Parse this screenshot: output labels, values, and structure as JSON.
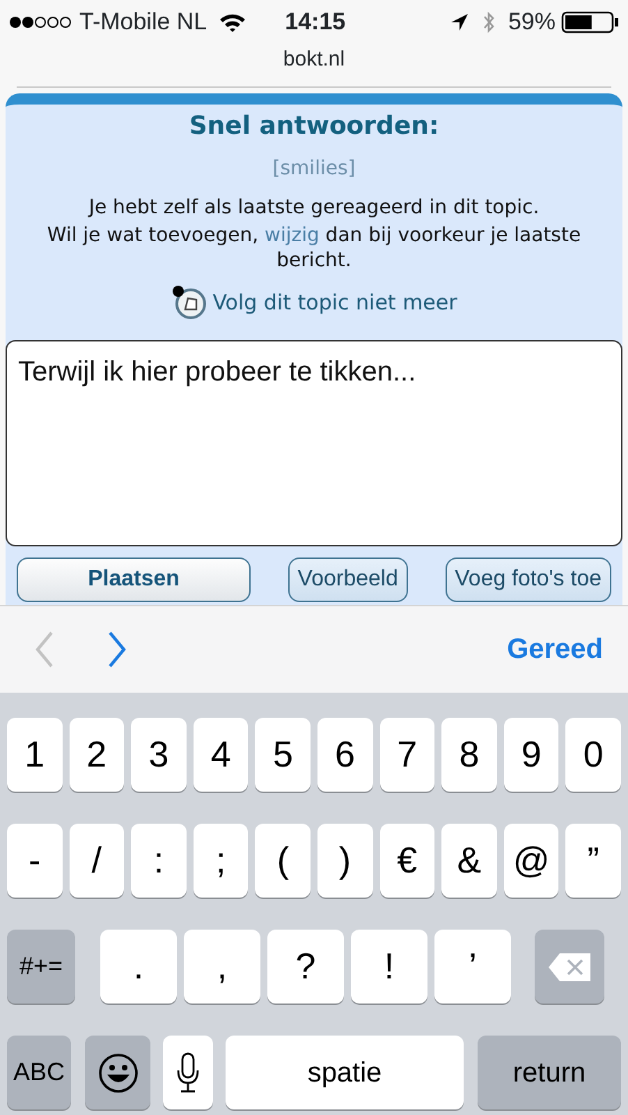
{
  "status_bar": {
    "carrier": "T-Mobile NL",
    "time": "14:15",
    "battery": "59%"
  },
  "address_bar": {
    "domain": "bokt.nl"
  },
  "reply_panel": {
    "title": "Snel antwoorden:",
    "smilies_link": "[smilies]",
    "notice": "Je hebt zelf als laatste gereageerd in dit topic.",
    "notice_2_before": "Wil je wat toevoegen,",
    "notice_2_link": "wijzig",
    "notice_2_after": "dan bij voorkeur je laatste bericht.",
    "unfollow_link": "Volg dit topic niet meer",
    "message": "Terwijl ik hier probeer te tikken...",
    "buttons": [
      {
        "label": "Plaatsen",
        "primary": true
      },
      {
        "label": "Voorbeeld",
        "primary": false
      },
      {
        "label": "Voeg foto's toe",
        "primary": false
      }
    ]
  },
  "form_toolbar": {
    "previous_disabled": true,
    "next_disabled": false,
    "done": "Gereed"
  },
  "keyboard": {
    "number_keys": [
      {
        "kind": "char",
        "label": "1"
      },
      {
        "kind": "char",
        "label": "2"
      },
      {
        "kind": "char",
        "label": "3"
      },
      {
        "kind": "char",
        "label": "4"
      },
      {
        "kind": "char",
        "label": "5"
      },
      {
        "kind": "char",
        "label": "6"
      },
      {
        "kind": "char",
        "label": "7"
      },
      {
        "kind": "char",
        "label": "8"
      },
      {
        "kind": "char",
        "label": "9"
      },
      {
        "kind": "char",
        "label": "0"
      }
    ],
    "symbol_keys": [
      {
        "kind": "char",
        "label": "-"
      },
      {
        "kind": "char",
        "label": "/"
      },
      {
        "kind": "char",
        "label": ":"
      },
      {
        "kind": "char",
        "label": ";"
      },
      {
        "kind": "char",
        "label": "("
      },
      {
        "kind": "char",
        "label": ")"
      },
      {
        "kind": "char",
        "label": "€"
      },
      {
        "kind": "char",
        "label": "&"
      },
      {
        "kind": "char",
        "label": "@"
      },
      {
        "kind": "char",
        "label": "”"
      }
    ],
    "punctuation_keys": [
      {
        "kind": "shift",
        "label": "#+="
      },
      {
        "kind": "wide",
        "label": "."
      },
      {
        "kind": "wide",
        "label": ","
      },
      {
        "kind": "wide",
        "label": "?"
      },
      {
        "kind": "wide",
        "label": "!"
      },
      {
        "kind": "wide",
        "label": "’"
      },
      {
        "kind": "backspace"
      }
    ],
    "bottom_keys": [
      {
        "kind": "abc",
        "label": "ABC"
      },
      {
        "kind": "emoji"
      },
      {
        "kind": "mic"
      },
      {
        "kind": "space",
        "label": "spatie"
      },
      {
        "kind": "return",
        "label": "return"
      }
    ]
  }
}
